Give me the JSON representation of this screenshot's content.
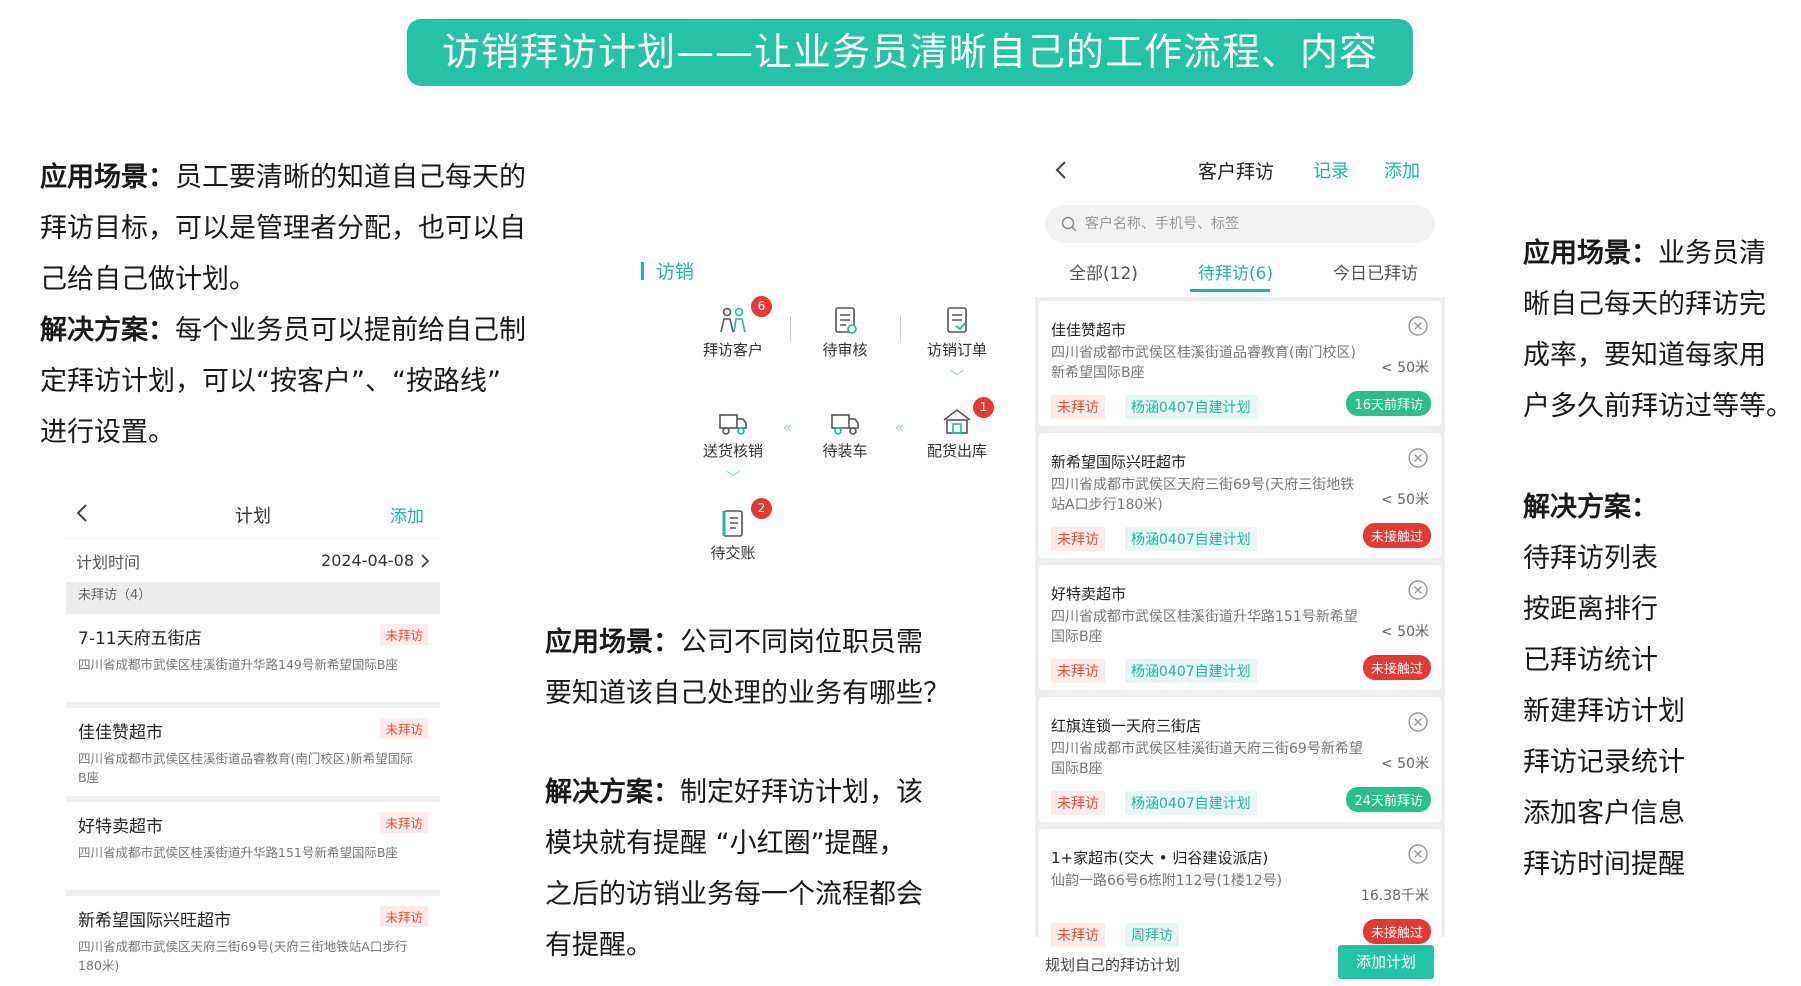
{
  "banner": {
    "title": "访销拜访计划——让业务员清晰自己的工作流程、内容"
  },
  "left_text": {
    "scene_label": "应用场景：",
    "scene_lines": [
      "员工要清晰的知道自己每天的",
      "拜访目标，可以是管理者分配，也可以自",
      "己给自己做计划。"
    ],
    "solution_label": "解决方案：",
    "solution_lines": [
      "每个业务员可以提前给自己制",
      "定拜访计划，可以“按客户”、“按路线”",
      "进行设置。"
    ]
  },
  "plan_phone": {
    "title": "计划",
    "add": "添加",
    "date_label": "计划时间",
    "date_value": "2024-04-08",
    "section": "未拜访（4）",
    "items": [
      {
        "name": "7-11天府五街店",
        "address": "四川省成都市武侯区桂溪街道升华路149号新希望国际B座",
        "tag": "未拜访"
      },
      {
        "name": "佳佳赞超市",
        "address": "四川省成都市武侯区桂溪街道品睿教育(南门校区)新希望国际B座",
        "tag": "未拜访"
      },
      {
        "name": "好特卖超市",
        "address": "四川省成都市武侯区桂溪街道升华路151号新希望国际B座",
        "tag": "未拜访"
      },
      {
        "name": "新希望国际兴旺超市",
        "address": "四川省成都市武侯区天府三街69号(天府三街地铁站A口步行180米)",
        "tag": "未拜访"
      }
    ]
  },
  "flow": {
    "header": "访销",
    "items": [
      {
        "label": "拜访客户",
        "badge": "6",
        "icon": "visit-customer-icon"
      },
      {
        "label": "待审核",
        "badge": "",
        "icon": "review-icon"
      },
      {
        "label": "访销订单",
        "badge": "",
        "icon": "order-icon"
      },
      {
        "label": "送货核销",
        "badge": "",
        "icon": "delivery-verify-icon"
      },
      {
        "label": "待装车",
        "badge": "",
        "icon": "loading-truck-icon"
      },
      {
        "label": "配货出库",
        "badge": "1",
        "icon": "warehouse-icon"
      },
      {
        "label": "待交账",
        "badge": "2",
        "icon": "ledger-icon"
      }
    ],
    "accent": "#26b3a0"
  },
  "middle_text": {
    "scene_label": "应用场景：",
    "scene_lines": [
      "公司不同岗位职员需",
      "要知道该自己处理的业务有哪些？"
    ],
    "solution_label": "解决方案：",
    "solution_lines": [
      "制定好拜访计划，该",
      "模块就有提醒  “小红圈”提醒，",
      "之后的访销业务每一个流程都会",
      "有提醒。"
    ]
  },
  "visit_phone": {
    "title": "客户拜访",
    "record": "记录",
    "add": "添加",
    "search_placeholder": "客户名称、手机号、标签",
    "tabs": [
      "全部(12)",
      "待拜访(6)",
      "今日已拜访"
    ],
    "cards": [
      {
        "name": "佳佳赞超市",
        "address": "四川省成都市武侯区桂溪街道品睿教育(南门校区)新希望国际B座",
        "distance": "< 50米",
        "tag1": "未拜访",
        "tag2": "杨涵0407自建计划",
        "status": "16天前拜访",
        "status_color": "green"
      },
      {
        "name": "新希望国际兴旺超市",
        "address": "四川省成都市武侯区天府三街69号(天府三街地铁站A口步行180米)",
        "distance": "< 50米",
        "tag1": "未拜访",
        "tag2": "杨涵0407自建计划",
        "status": "未接触过",
        "status_color": "red"
      },
      {
        "name": "好特卖超市",
        "address": "四川省成都市武侯区桂溪街道升华路151号新希望国际B座",
        "distance": "< 50米",
        "tag1": "未拜访",
        "tag2": "杨涵0407自建计划",
        "status": "未接触过",
        "status_color": "red"
      },
      {
        "name": "红旗连锁一天府三街店",
        "address": "四川省成都市武侯区桂溪街道天府三街69号新希望国际B座",
        "distance": "< 50米",
        "tag1": "未拜访",
        "tag2": "杨涵0407自建计划",
        "status": "24天前拜访",
        "status_color": "green"
      },
      {
        "name": "1+家超市(交大 • 归谷建设派店)",
        "address": "仙韵一路66号6栋附112号(1楼12号)",
        "distance": "16.38千米",
        "tag1": "未拜访",
        "tag2": "周拜访",
        "status": "未接触过",
        "status_color": "red"
      }
    ],
    "footer_text": "规划自己的拜访计划",
    "footer_button": "添加计划"
  },
  "right_text": {
    "scene_label": "应用场景：",
    "scene_lines": [
      "业务员清",
      "晰自己每天的拜访完",
      "成率，要知道每家用",
      "户多久前拜访过等等。"
    ],
    "solution_label": "解决方案：",
    "solution_items": [
      "待拜访列表",
      "按距离排行",
      "已拜访统计",
      "新建拜访计划",
      "拜访记录统计",
      "添加客户信息",
      "拜访时间提醒"
    ]
  }
}
